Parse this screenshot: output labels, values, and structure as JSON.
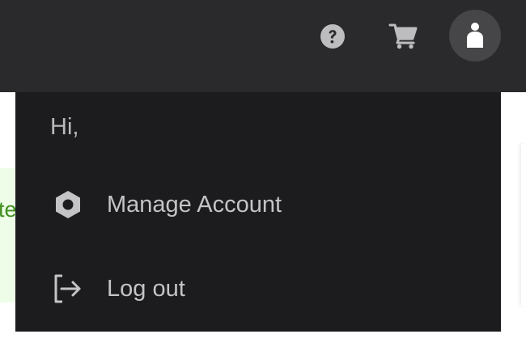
{
  "header": {
    "icons": {
      "help": "help-icon",
      "cart": "cart-icon",
      "account": "user-icon"
    }
  },
  "background": {
    "notice_text": "te"
  },
  "account_menu": {
    "greeting": "Hi,",
    "items": [
      {
        "label": "Manage Account",
        "icon": "settings-hexagon-icon"
      },
      {
        "label": "Log out",
        "icon": "logout-icon"
      }
    ]
  },
  "colors": {
    "topbar": "#2a2a2c",
    "menu_background": "#1c1c1e",
    "menu_text": "#c4c4c7",
    "notice_background": "#eefde8",
    "notice_text": "#3f8f1c"
  }
}
